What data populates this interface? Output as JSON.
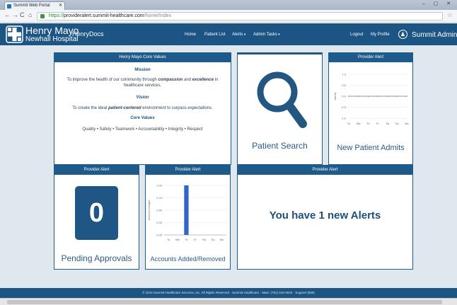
{
  "browser": {
    "tab_title": "Summit Web Portal",
    "url_scheme": "https://",
    "url_host": "provideralert.summit-healthcare.com",
    "url_path": "/home/Index"
  },
  "header": {
    "brand_line1": "Henry Mayo",
    "brand_line2": "Newhall Hospital",
    "product": "HenryDocs",
    "nav": [
      {
        "label": "Home"
      },
      {
        "label": "Patient List"
      },
      {
        "label": "Alerts"
      },
      {
        "label": "Admin Tasks"
      }
    ],
    "logout": "Logout",
    "profile": "My Profile",
    "user": "Summit Admin"
  },
  "values_card": {
    "title": "Henry Mayo Core Values",
    "mission_title": "Mission",
    "mission_pre": "To improve the health of our community through ",
    "mission_em1": "compassion",
    "mission_mid": " and ",
    "mission_em2": "excellence",
    "mission_post": " in healthcare services.",
    "vision_title": "Vision",
    "vision_pre": "To create the ideal ",
    "vision_em": "patient-centered",
    "vision_post": " environment to surpass expectations.",
    "core_title": "Core Values",
    "core_list": "Quality • Safety • Teamwork • Accountability • Integrity • Respect"
  },
  "patient_search": {
    "label": "Patient Search"
  },
  "new_admits": {
    "header": "Provider Alert",
    "label": "New Patient Admits",
    "chart_data": {
      "type": "line",
      "categories": [
        "Tu",
        "We",
        "Th",
        "Fr",
        "Sa",
        "Su",
        "Mo"
      ],
      "series": [
        {
          "values": [
            0,
            0,
            0,
            0,
            0,
            0,
            0
          ]
        }
      ],
      "ylabel": "Admits",
      "yticks": [
        "1.0",
        "0.5",
        "0.0",
        "-0.5",
        "-1.0"
      ],
      "ylim": [
        -1.0,
        1.0
      ]
    }
  },
  "pending": {
    "header": "Provider Alert",
    "count": "0",
    "label": "Pending Approvals"
  },
  "accounts": {
    "header": "Provider Alert",
    "label": "Accounts Added/Removed",
    "chart_data": {
      "type": "bar",
      "categories": [
        "Tu",
        "We",
        "Th",
        "Fr",
        "Sa",
        "Su",
        "Mo"
      ],
      "values": [
        0,
        0,
        1,
        0,
        0,
        0,
        0
      ],
      "ylabel": "Accounts Changed",
      "yticks": [
        "1.00",
        "0.75",
        "0.50",
        "0.25",
        "0.00"
      ],
      "ylim": [
        0,
        1.0
      ],
      "bar_color": "#2f66c8"
    }
  },
  "alerts_card": {
    "header": "Provider Alert",
    "message": "You have 1 new Alerts"
  },
  "footer": {
    "text": "© 2015 Summit Healthcare Services, Inc. All Rights Reserved   ·   Summit Healthcare   ·   Main: (781) 519-4840   ·   Support (866)"
  },
  "colors": {
    "primary": "#1c5584",
    "accent": "#2f66c8",
    "background": "#dfe8ee"
  }
}
